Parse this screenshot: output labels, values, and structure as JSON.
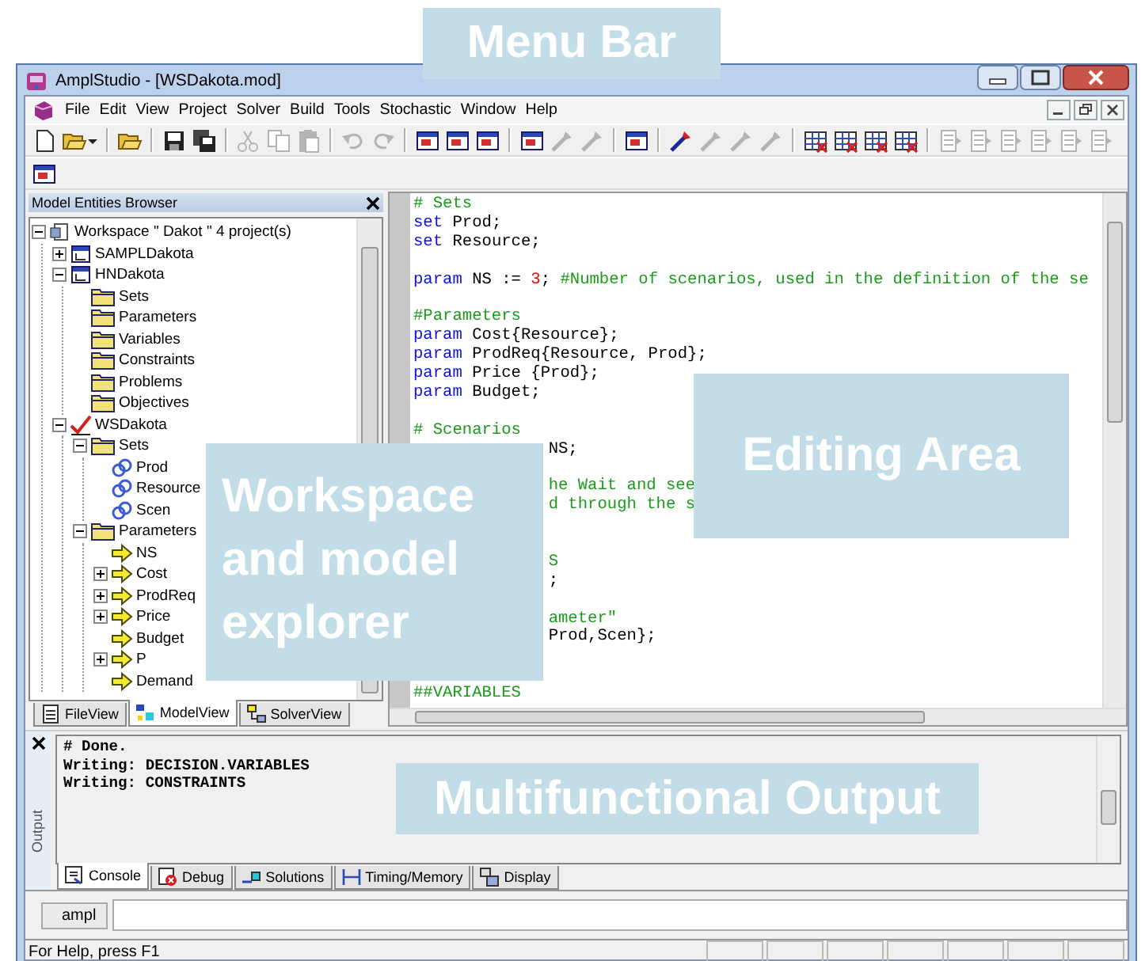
{
  "window": {
    "title": "AmplStudio - [WSDakota.mod]"
  },
  "menu": [
    {
      "label": "File"
    },
    {
      "label": "Edit"
    },
    {
      "label": "View"
    },
    {
      "label": "Project"
    },
    {
      "label": "Solver"
    },
    {
      "label": "Build"
    },
    {
      "label": "Tools"
    },
    {
      "label": "Stochastic"
    },
    {
      "label": "Window"
    },
    {
      "label": "Help"
    }
  ],
  "toolbars": [
    [
      [
        {
          "kind": "page",
          "disabled": false
        },
        {
          "kind": "folder",
          "disabled": false
        },
        {
          "kind": "caret"
        }
      ],
      [
        {
          "kind": "folder",
          "disabled": false
        }
      ],
      [
        {
          "kind": "floppy",
          "disabled": false
        },
        {
          "kind": "floppies",
          "disabled": false
        }
      ],
      [
        {
          "kind": "scissors",
          "disabled": true
        },
        {
          "kind": "pages",
          "disabled": true
        },
        {
          "kind": "clipboard",
          "disabled": true
        }
      ],
      [
        {
          "kind": "undo",
          "disabled": true
        },
        {
          "kind": "redo",
          "disabled": true
        }
      ],
      [
        {
          "kind": "frame",
          "disabled": false
        },
        {
          "kind": "frame",
          "disabled": false
        },
        {
          "kind": "frame",
          "disabled": false
        }
      ],
      [
        {
          "kind": "frame",
          "disabled": false
        },
        {
          "kind": "wand",
          "disabled": true
        },
        {
          "kind": "wand",
          "disabled": true
        }
      ],
      [
        {
          "kind": "frame",
          "disabled": false
        }
      ],
      [
        {
          "kind": "wand",
          "disabled": false
        },
        {
          "kind": "wand",
          "disabled": true
        },
        {
          "kind": "wand",
          "disabled": true
        },
        {
          "kind": "wand",
          "disabled": true
        }
      ],
      [
        {
          "kind": "grid",
          "disabled": false
        },
        {
          "kind": "grid",
          "disabled": false
        },
        {
          "kind": "grid",
          "disabled": false
        },
        {
          "kind": "grid",
          "disabled": false
        }
      ],
      [
        {
          "kind": "list",
          "disabled": true
        },
        {
          "kind": "list",
          "disabled": true
        },
        {
          "kind": "list",
          "disabled": true
        },
        {
          "kind": "list",
          "disabled": true
        },
        {
          "kind": "list",
          "disabled": true
        },
        {
          "kind": "list",
          "disabled": true
        }
      ]
    ],
    [
      [
        {
          "kind": "frame",
          "disabled": false
        }
      ]
    ]
  ],
  "explorer": {
    "title": "Model Entities Browser",
    "tree": [
      {
        "kind": "workspace",
        "label": "Workspace \" Dakot \" 4 project(s)",
        "expanded": true,
        "children": [
          {
            "kind": "project",
            "label": "SAMPLDakota",
            "expanded": false
          },
          {
            "kind": "project",
            "label": "HNDakota",
            "expanded": true,
            "children": [
              {
                "kind": "folder",
                "label": "Sets"
              },
              {
                "kind": "folder",
                "label": "Parameters"
              },
              {
                "kind": "folder",
                "label": "Variables"
              },
              {
                "kind": "folder",
                "label": "Constraints"
              },
              {
                "kind": "folder",
                "label": "Problems"
              },
              {
                "kind": "folder",
                "label": "Objectives"
              }
            ]
          },
          {
            "kind": "project-active",
            "label": "WSDakota",
            "expanded": true,
            "children": [
              {
                "kind": "folder",
                "label": "Sets",
                "expanded": true,
                "children": [
                  {
                    "kind": "set",
                    "label": "Prod"
                  },
                  {
                    "kind": "set",
                    "label": "Resource"
                  },
                  {
                    "kind": "set",
                    "label": "Scen"
                  }
                ]
              },
              {
                "kind": "folder",
                "label": "Parameters",
                "expanded": true,
                "children": [
                  {
                    "kind": "param",
                    "label": "NS"
                  },
                  {
                    "kind": "param",
                    "label": "Cost",
                    "expanded": false
                  },
                  {
                    "kind": "param",
                    "label": "ProdReq",
                    "expanded": false
                  },
                  {
                    "kind": "param",
                    "label": "Price",
                    "expanded": false
                  },
                  {
                    "kind": "param",
                    "label": "Budget"
                  },
                  {
                    "kind": "param",
                    "label": "P",
                    "expanded": false
                  },
                  {
                    "kind": "param",
                    "label": "Demand"
                  }
                ]
              }
            ]
          }
        ]
      }
    ],
    "tabs": [
      {
        "kind": "file",
        "label": "FileView",
        "selected": false
      },
      {
        "kind": "model",
        "label": "ModelView",
        "selected": true
      },
      {
        "kind": "solver",
        "label": "SolverView",
        "selected": false
      }
    ]
  },
  "editor": {
    "lines": [
      {
        "kind": "code",
        "segments": [
          {
            "kind": "comment",
            "text": "# Sets"
          }
        ]
      },
      {
        "kind": "code",
        "segments": [
          {
            "kind": "keyword",
            "text": "set"
          },
          {
            "kind": "plain",
            "text": " Prod;"
          }
        ]
      },
      {
        "kind": "code",
        "segments": [
          {
            "kind": "keyword",
            "text": "set"
          },
          {
            "kind": "plain",
            "text": " Resource;"
          }
        ]
      },
      {
        "kind": "blank"
      },
      {
        "kind": "code",
        "segments": [
          {
            "kind": "keyword",
            "text": "param"
          },
          {
            "kind": "plain",
            "text": " NS := "
          },
          {
            "kind": "number",
            "text": "3"
          },
          {
            "kind": "plain",
            "text": "; "
          },
          {
            "kind": "comment",
            "text": "#Number of scenarios, used in the definition of the se"
          }
        ]
      },
      {
        "kind": "blank"
      },
      {
        "kind": "code",
        "segments": [
          {
            "kind": "comment",
            "text": "#Parameters"
          }
        ]
      },
      {
        "kind": "code",
        "segments": [
          {
            "kind": "keyword",
            "text": "param"
          },
          {
            "kind": "plain",
            "text": " Cost{Resource};"
          }
        ]
      },
      {
        "kind": "code",
        "segments": [
          {
            "kind": "keyword",
            "text": "param"
          },
          {
            "kind": "plain",
            "text": " ProdReq{Resource, Prod};"
          }
        ]
      },
      {
        "kind": "code",
        "segments": [
          {
            "kind": "keyword",
            "text": "param"
          },
          {
            "kind": "plain",
            "text": " Price {Prod};"
          }
        ]
      },
      {
        "kind": "code",
        "segments": [
          {
            "kind": "keyword",
            "text": "param"
          },
          {
            "kind": "plain",
            "text": " Budget;"
          }
        ]
      },
      {
        "kind": "blank"
      },
      {
        "kind": "code",
        "segments": [
          {
            "kind": "comment",
            "text": "# Scenarios"
          }
        ]
      },
      {
        "kind": "tail",
        "segments": [
          {
            "kind": "plain",
            "text": "NS;"
          }
        ]
      },
      {
        "kind": "blank"
      },
      {
        "kind": "tail",
        "segments": [
          {
            "kind": "comment",
            "text": "he Wait and see"
          }
        ]
      },
      {
        "kind": "tail",
        "segments": [
          {
            "kind": "comment",
            "text": "d through the s"
          }
        ]
      },
      {
        "kind": "blank"
      },
      {
        "kind": "blank"
      },
      {
        "kind": "tail",
        "segments": [
          {
            "kind": "comment",
            "text": "S"
          }
        ]
      },
      {
        "kind": "tail",
        "segments": [
          {
            "kind": "plain",
            "text": ";"
          }
        ]
      },
      {
        "kind": "blank"
      },
      {
        "kind": "tail",
        "segments": [
          {
            "kind": "comment",
            "text": "ameter\""
          }
        ]
      },
      {
        "kind": "tail",
        "segments": [
          {
            "kind": "plain",
            "text": "Prod,Scen};"
          }
        ]
      },
      {
        "kind": "blank"
      },
      {
        "kind": "blank"
      },
      {
        "kind": "code",
        "segments": [
          {
            "kind": "comment",
            "text": "##VARIABLES"
          }
        ]
      }
    ]
  },
  "output": {
    "side_label": "Output",
    "lines": [
      "# Done.",
      "Writing: DECISION.VARIABLES",
      "Writing: CONSTRAINTS"
    ],
    "tabs": [
      {
        "kind": "console",
        "label": "Console",
        "selected": true
      },
      {
        "kind": "debug",
        "label": "Debug",
        "selected": false
      },
      {
        "kind": "solutions",
        "label": "Solutions",
        "selected": false
      },
      {
        "kind": "timing",
        "label": "Timing/Memory",
        "selected": false
      },
      {
        "kind": "display",
        "label": "Display",
        "selected": false
      }
    ]
  },
  "command": {
    "label": "ampl"
  },
  "status_bar": {
    "text": "For Help, press F1"
  },
  "annotations": [
    {
      "kind": "menu",
      "text": "Menu Bar"
    },
    {
      "kind": "explorer",
      "text": "Workspace and model explorer"
    },
    {
      "kind": "editor",
      "text": "Editing Area"
    },
    {
      "kind": "output",
      "text": "Multifunctional Output"
    }
  ]
}
